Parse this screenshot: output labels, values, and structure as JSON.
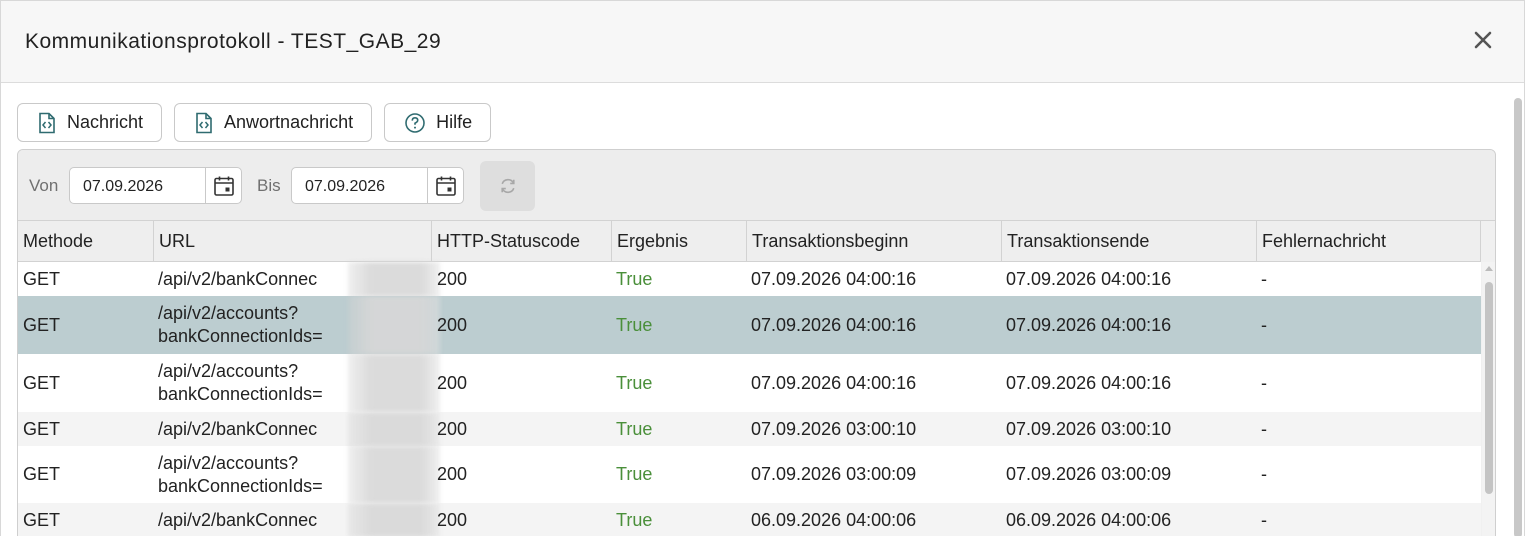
{
  "dialog": {
    "title": "Kommunikationsprotokoll - TEST_GAB_29"
  },
  "toolbar": {
    "message_label": "Nachricht",
    "response_label": "Anwortnachricht",
    "help_label": "Hilfe"
  },
  "filter": {
    "from_label": "Von",
    "from_value": "07.09.2026",
    "to_label": "Bis",
    "to_value": "07.09.2026"
  },
  "table": {
    "columns": [
      "Methode",
      "URL",
      "HTTP-Statuscode",
      "Ergebnis",
      "Transaktionsbeginn",
      "Transaktionsende",
      "Fehlernachricht"
    ],
    "rows": [
      {
        "method": "GET",
        "url1": "/api/v2/bankConnec",
        "url2": "",
        "status": "200",
        "result": "True",
        "start": "07.09.2026 04:00:16",
        "end": "07.09.2026 04:00:16",
        "error": "-"
      },
      {
        "method": "GET",
        "url1": "/api/v2/accounts?",
        "url2": "bankConnectionIds=",
        "status": "200",
        "result": "True",
        "start": "07.09.2026 04:00:16",
        "end": "07.09.2026 04:00:16",
        "error": "-"
      },
      {
        "method": "GET",
        "url1": "/api/v2/accounts?",
        "url2": "bankConnectionIds=",
        "status": "200",
        "result": "True",
        "start": "07.09.2026 04:00:16",
        "end": "07.09.2026 04:00:16",
        "error": "-"
      },
      {
        "method": "GET",
        "url1": "/api/v2/bankConnec",
        "url2": "",
        "status": "200",
        "result": "True",
        "start": "07.09.2026 03:00:10",
        "end": "07.09.2026 03:00:10",
        "error": "-"
      },
      {
        "method": "GET",
        "url1": "/api/v2/accounts?",
        "url2": "bankConnectionIds=",
        "status": "200",
        "result": "True",
        "start": "07.09.2026 03:00:09",
        "end": "07.09.2026 03:00:09",
        "error": "-"
      },
      {
        "method": "GET",
        "url1": "/api/v2/bankConnec",
        "url2": "",
        "status": "200",
        "result": "True",
        "start": "06.09.2026 04:00:06",
        "end": "06.09.2026 04:00:06",
        "error": "-"
      }
    ]
  },
  "colors": {
    "result_green": "#4a8f3a",
    "selected_row": "#bccdd0",
    "icon_teal": "#2f6b70"
  },
  "icons": {
    "close": "close-icon",
    "message": "code-file-icon",
    "help": "help-circle-icon",
    "calendar": "calendar-icon",
    "refresh": "refresh-icon"
  }
}
